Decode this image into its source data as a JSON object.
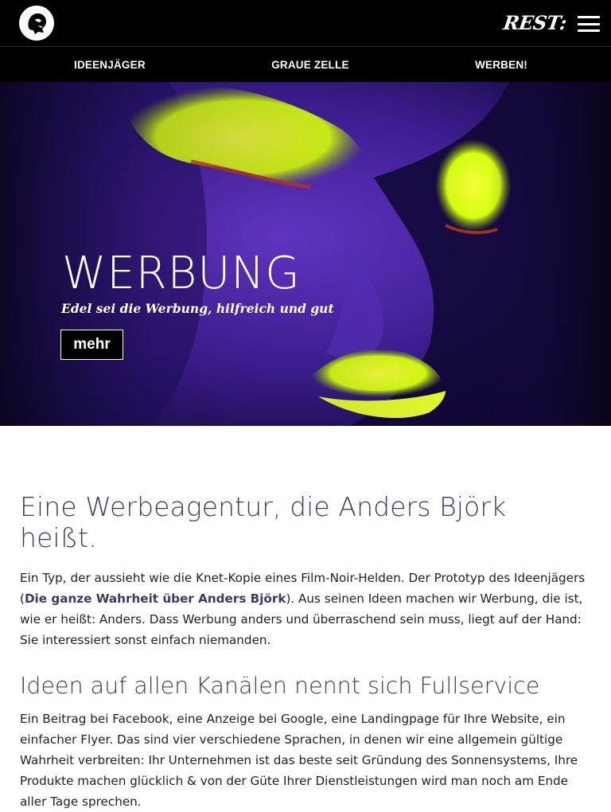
{
  "header": {
    "brand_logo": "lion-head-logo",
    "rest_logo": "REST:",
    "menu_icon": "hamburger-icon"
  },
  "nav": {
    "items": [
      {
        "label": "IDEENJÄGER"
      },
      {
        "label": "GRAUE ZELLE"
      },
      {
        "label": "WERBEN!"
      }
    ]
  },
  "hero": {
    "title": "WERBUNG",
    "subtitle": "Edel sei die Werbung, hilfreich und gut",
    "button_label": "mehr"
  },
  "article": {
    "heading": "Eine Werbeagentur, die Anders Björk heißt.",
    "para1_a": "Ein Typ, der aussieht wie die Knet-Kopie eines Film-Noir-Helden. Der Prototyp des Ideenjägers (",
    "para1_link": "Die ganze Wahrheit über Anders Björk",
    "para1_b": "). Aus seinen Ideen machen wir Werbung, die ist, wie er heißt: Anders. Dass Werbung anders und überraschend sein muss, liegt auf der Hand: Sie interessiert sonst einfach niemanden.",
    "subheading": "Ideen auf allen Kanälen nennt sich Fullservice",
    "para2": "Ein Beitrag bei Facebook, eine Anzeige bei Google, eine Landingpage für Ihre Website, ein einfacher Flyer. Das sind vier verschiedene Sprachen, in denen wir eine allgemein gültige Wahrheit verbreiten: Ihr Unternehmen ist das beste seit Gründung des Sonnensystems, Ihre Produkte machen glücklich & von der Güte Ihrer Dienstleistungen wird man noch am Ende aller Tage sprechen."
  },
  "colors": {
    "accent": "#3d3a67",
    "neon": "#e8ff2a",
    "skin": "#4a2aa0"
  }
}
